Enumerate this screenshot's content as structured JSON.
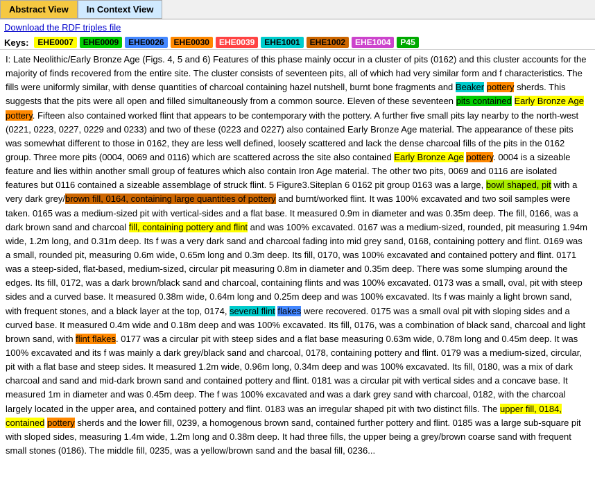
{
  "tabs": {
    "abstract": "Abstract View",
    "context": "In Context View"
  },
  "download": {
    "label": "Download the RDF triples file"
  },
  "keys": {
    "label": "Keys:",
    "badges": [
      {
        "id": "EHE0007",
        "color": "#ffff00",
        "text_color": "#000"
      },
      {
        "id": "EHE0009",
        "color": "#00cc00",
        "text_color": "#000"
      },
      {
        "id": "EHE0026",
        "color": "#4488ff",
        "text_color": "#000"
      },
      {
        "id": "EHE0030",
        "color": "#ff8800",
        "text_color": "#000"
      },
      {
        "id": "EHE0039",
        "color": "#ff4444",
        "text_color": "#fff"
      },
      {
        "id": "EHE1001",
        "color": "#00cccc",
        "text_color": "#000"
      },
      {
        "id": "EHE1002",
        "color": "#cc6600",
        "text_color": "#000"
      },
      {
        "id": "EHE1004",
        "color": "#cc44cc",
        "text_color": "#fff"
      },
      {
        "id": "P45",
        "color": "#00aa00",
        "text_color": "#fff"
      }
    ]
  }
}
